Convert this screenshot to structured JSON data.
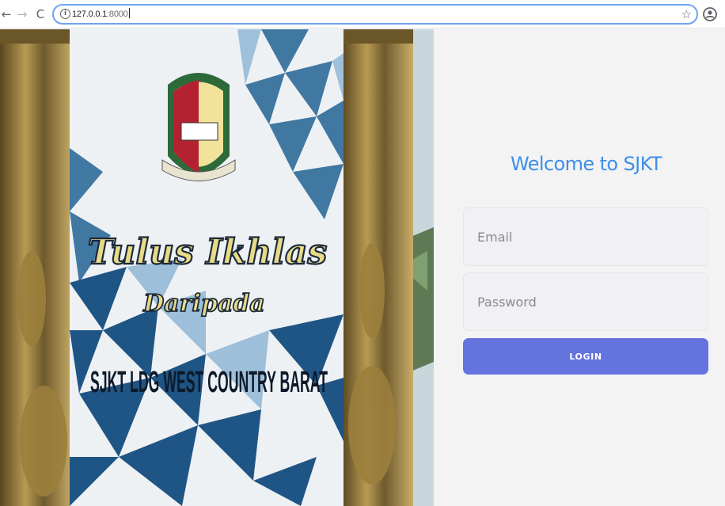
{
  "browser": {
    "url_host": "127.0.0.1",
    "url_port": ":8000",
    "back_icon": "arrow-left-icon",
    "forward_icon": "arrow-right-icon",
    "reload_icon": "reload-icon",
    "info_icon": "info-icon",
    "bookmark_icon": "star-icon",
    "profile_icon": "account-circle-icon"
  },
  "photo": {
    "banner_line1": "Tulus Ikhlas",
    "banner_line2": "Daripada",
    "banner_line3": "SJKT LDG WEST COUNTRY BARAT",
    "crest_icon": "school-crest-icon"
  },
  "login": {
    "heading": "Welcome to SJKT",
    "email_placeholder": "Email",
    "password_placeholder": "Password",
    "button_label": "LOGIN"
  },
  "colors": {
    "heading": "#3d8fe8",
    "button": "#6573de",
    "panel_bg": "#f3f3f4"
  }
}
